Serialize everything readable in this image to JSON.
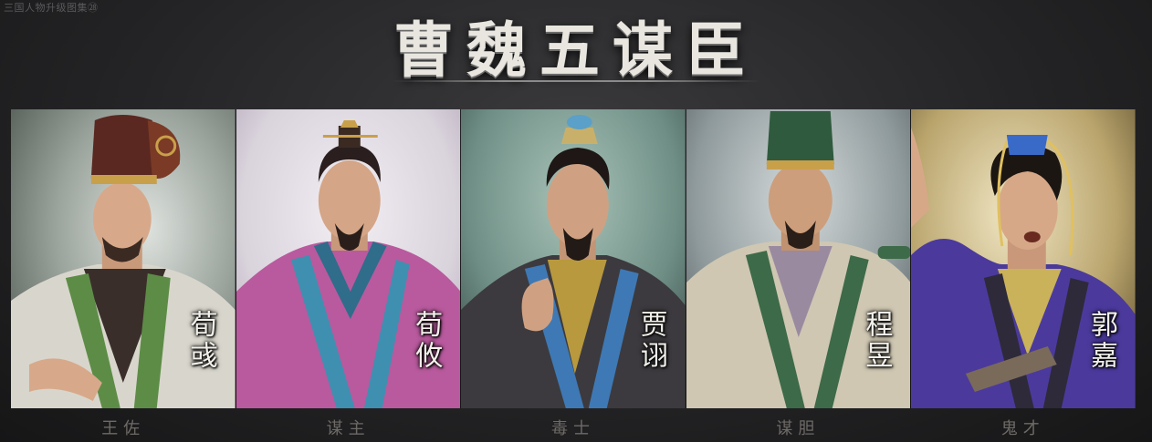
{
  "corner_text": "三国人物升级图集㉘",
  "title": "曹魏五谋臣",
  "advisors": [
    {
      "name": "荀彧",
      "caption": "王佐",
      "robe_color": "#d8d6cc",
      "bg_color": "#9aa39c"
    },
    {
      "name": "荀攸",
      "caption": "谋主",
      "robe_color": "#b95a9e",
      "bg_color": "#d9d3dc"
    },
    {
      "name": "贾诩",
      "caption": "毒士",
      "robe_color": "#3c3a3e",
      "bg_color": "#6f8f86"
    },
    {
      "name": "程昱",
      "caption": "谋胆",
      "robe_color": "#cfc7b2",
      "bg_color": "#8f9a9c"
    },
    {
      "name": "郭嘉",
      "caption": "鬼才",
      "robe_color": "#4b3a9c",
      "bg_color": "#b9a46c"
    }
  ]
}
